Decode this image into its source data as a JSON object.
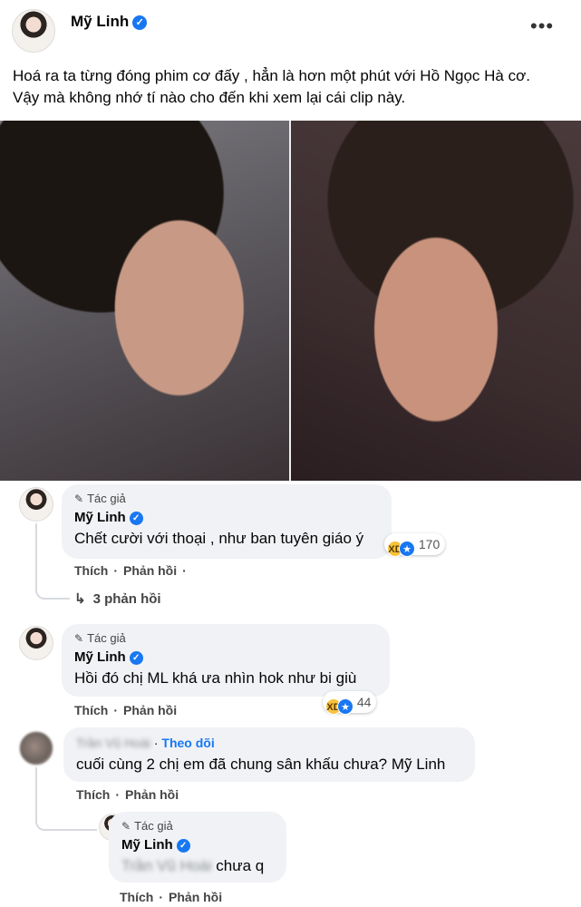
{
  "post": {
    "author": "Mỹ Linh",
    "verified_mark": "✓",
    "more_icon": "•••",
    "text_line1": "Hoá ra ta từng đóng phim cơ đấy , hẳn là hơn một phút với Hồ Ngọc Hà cơ.",
    "text_line2": "Vậy mà không nhớ tí nào cho đến khi xem lại cái clip này."
  },
  "labels": {
    "author_badge": "Tác giả",
    "like": "Thích",
    "reply": "Phản hồi",
    "separator": "·",
    "follow": "Theo dõi"
  },
  "comments": [
    {
      "name": "Mỹ Linh",
      "text": "Chết cười với thoại , như ban tuyên giáo ý",
      "reaction_count": "170",
      "replies_label": "3 phản hồi"
    },
    {
      "name": "Mỹ Linh",
      "text": "Hồi đó chị ML khá ưa nhìn hok như bi giù",
      "reaction_count": "44"
    },
    {
      "name": "Trần Vũ Hoài",
      "text": "cuối cùng 2 chị em đã chung sân khấu chưa? Mỹ Linh"
    },
    {
      "name": "Mỹ Linh",
      "mention": "Trần Vũ Hoài",
      "text": "chưa q"
    }
  ],
  "icons": {
    "pen": "✎",
    "haha": "😆",
    "like": "👍",
    "reply_arrow": "↳"
  },
  "colors": {
    "bubble": "#f0f2f5",
    "verified": "#1877f2",
    "follow": "#1877f2"
  }
}
